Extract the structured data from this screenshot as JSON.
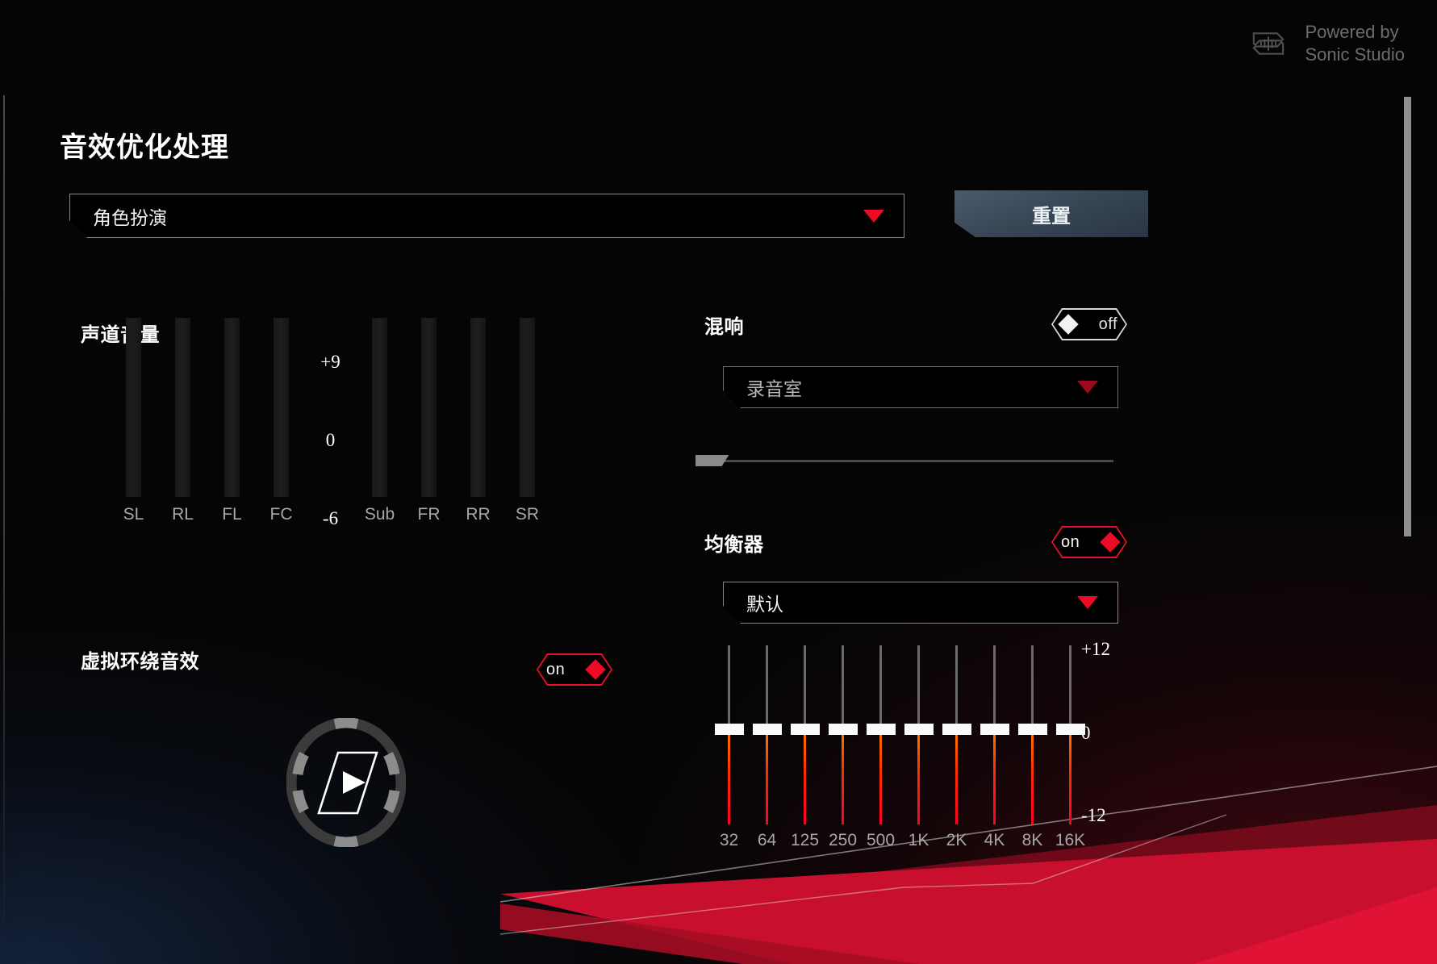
{
  "branding": {
    "logo_icon": "sonic-studio-logo-icon",
    "text": "Powered by\nSonic Studio"
  },
  "page": {
    "title": "音效优化处理"
  },
  "profile": {
    "label": "角色扮演",
    "arrow_icon": "chevron-down-icon"
  },
  "reset": {
    "label": "重置"
  },
  "channel_volume": {
    "title": "声道音量",
    "channels": [
      "SL",
      "RL",
      "FL",
      "FC",
      "Sub",
      "FR",
      "RR",
      "SR"
    ],
    "scale": [
      "+9",
      "0",
      "-6"
    ]
  },
  "virtual_surround": {
    "title": "虚拟环绕音效",
    "toggle_state": "on",
    "dial_icon": "surround-dial-icon"
  },
  "reverb": {
    "title": "混响",
    "toggle_state": "off",
    "preset": "录音室",
    "arrow_icon": "chevron-down-icon",
    "strength_percent": 8
  },
  "equalizer": {
    "title": "均衡器",
    "toggle_state": "on",
    "preset": "默认",
    "arrow_icon": "chevron-down-icon",
    "bands": [
      "32",
      "64",
      "125",
      "250",
      "500",
      "1K",
      "2K",
      "4K",
      "8K",
      "16K"
    ],
    "values": [
      0,
      0,
      0,
      0,
      0,
      0,
      0,
      0,
      0,
      0
    ],
    "scale": [
      "+12",
      "0",
      "-12"
    ]
  },
  "colors": {
    "accent_red": "#ee0a24",
    "toggle_on": "#e8102a",
    "toggle_off": "#d8d8d8",
    "panel_bg": "#050505"
  },
  "scrollbar": {
    "name": "vertical-scrollbar"
  }
}
